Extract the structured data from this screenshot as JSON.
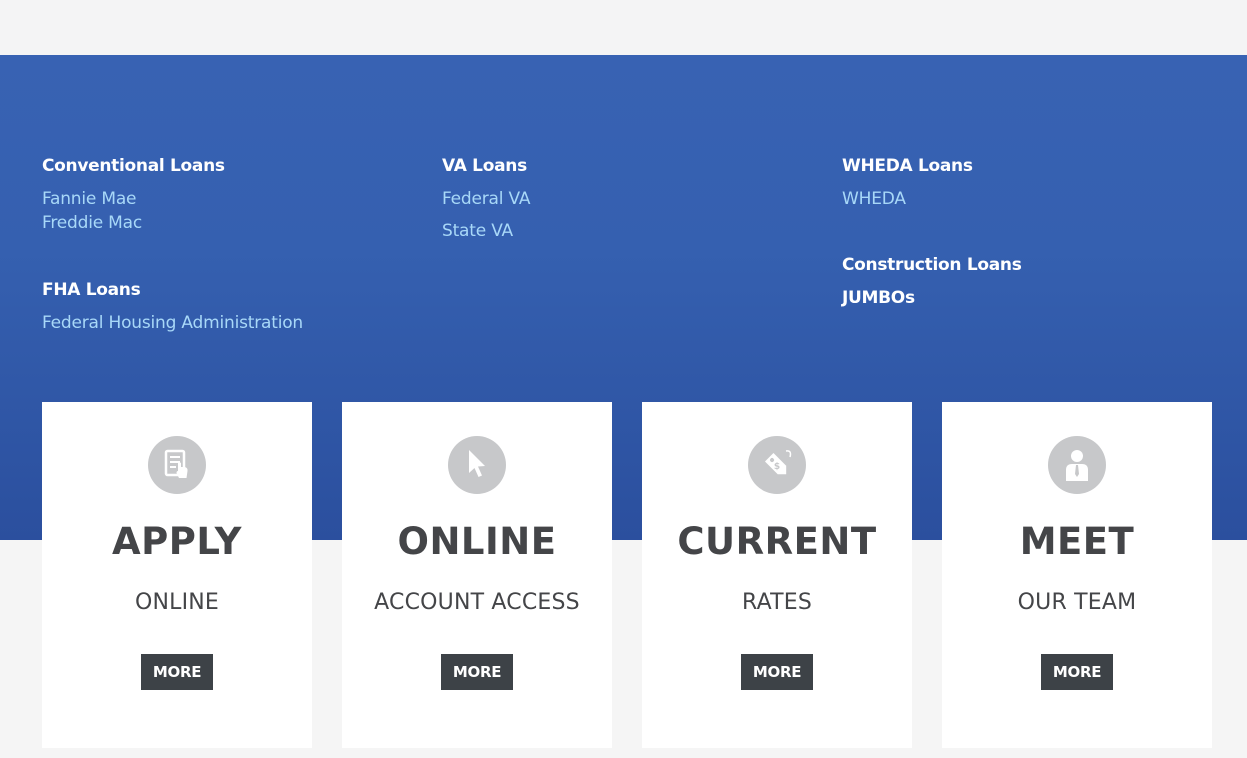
{
  "loans": {
    "conventional": {
      "heading": "Conventional Loans",
      "links": [
        "Fannie Mae",
        "Freddie Mac"
      ]
    },
    "fha": {
      "heading": "FHA Loans",
      "links": [
        "Federal Housing Administration"
      ]
    },
    "va": {
      "heading": "VA Loans",
      "links": [
        "Federal VA",
        "State VA"
      ]
    },
    "wheda": {
      "heading": "WHEDA Loans",
      "links": [
        "WHEDA"
      ]
    },
    "construction": {
      "heading": "Construction Loans"
    },
    "jumbo": {
      "heading": "JUMBOs"
    }
  },
  "cards": [
    {
      "title": "APPLY",
      "subtitle": "ONLINE",
      "button": "MORE",
      "icon": "document-icon"
    },
    {
      "title": "ONLINE",
      "subtitle": "ACCOUNT ACCESS",
      "button": "MORE",
      "icon": "cursor-icon"
    },
    {
      "title": "CURRENT",
      "subtitle": "RATES",
      "button": "MORE",
      "icon": "price-tag-icon"
    },
    {
      "title": "MEET",
      "subtitle": "OUR TEAM",
      "button": "MORE",
      "icon": "person-icon"
    }
  ],
  "colors": {
    "hero_top": "#3862b3",
    "hero_bottom": "#2b4f9e",
    "link": "#a8d8f8",
    "button": "#3d4247",
    "text_dark": "#444548",
    "icon_circle": "#c7c8ca"
  }
}
